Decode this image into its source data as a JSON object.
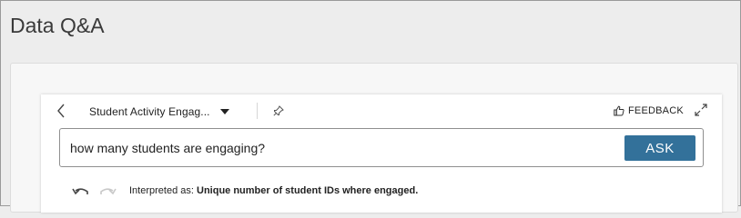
{
  "page": {
    "title": "Data Q&A"
  },
  "toolbar": {
    "dataset_name": "Student Activity Engag...",
    "feedback_label": "FEEDBACK",
    "icons": {
      "back": "chevron-left-icon",
      "dropdown": "caret-down-icon",
      "pin": "pin-icon",
      "feedback": "thumbs-up-icon",
      "expand": "expand-icon"
    }
  },
  "query": {
    "value": "how many students are engaging?",
    "ask_label": "ASK"
  },
  "interpretation": {
    "prefix": "Interpreted as:",
    "value": "Unique number of student IDs where engaged."
  },
  "colors": {
    "ask_button": "#33719a",
    "page_background": "#ededed"
  }
}
